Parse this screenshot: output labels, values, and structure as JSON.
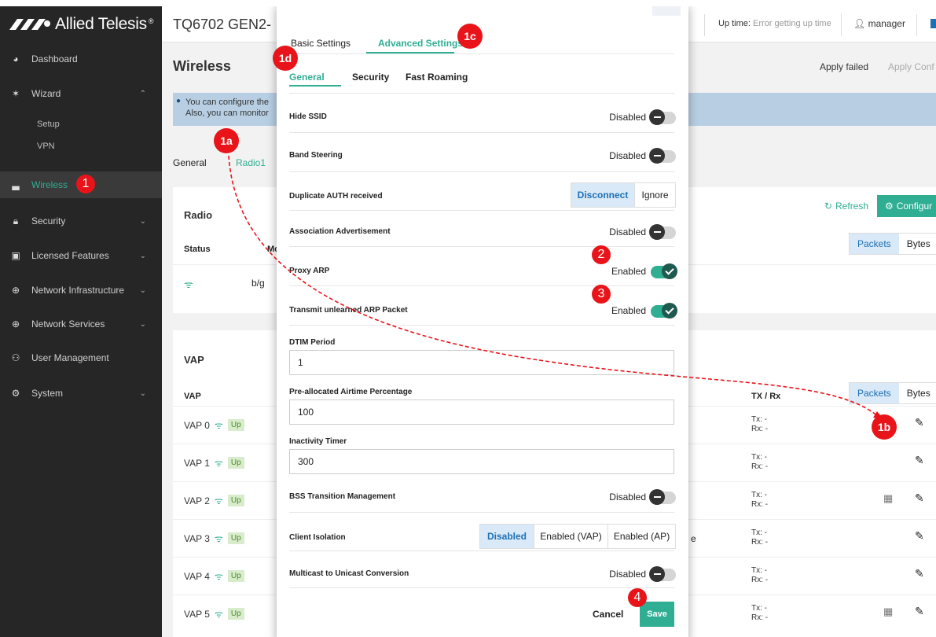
{
  "topbar": {
    "brand": "Allied Telesis",
    "product": "TQ6702 GEN2-",
    "uptime_label": "Up time:",
    "uptime_value": "Error getting up time",
    "user": "manager"
  },
  "sidebar": {
    "dashboard": "Dashboard",
    "wizard": "Wizard",
    "setup": "Setup",
    "vpn": "VPN",
    "wireless": "Wireless",
    "security": "Security",
    "licensed": "Licensed Features",
    "netinfra": "Network Infrastructure",
    "netservices": "Network Services",
    "usermgmt": "User Management",
    "system": "System"
  },
  "page": {
    "title": "Wireless",
    "apply_failed": "Apply failed",
    "apply_config": "Apply Conf",
    "info_line1": "You can configure the",
    "info_line2": "Also, you can monitor",
    "tab_general": "General",
    "tab_radio1": "Radio1"
  },
  "radio_card": {
    "title": "Radio",
    "refresh": "Refresh",
    "configure": "Configur",
    "col_status": "Status",
    "col_mode": "Mo",
    "packets": "Packets",
    "bytes": "Bytes",
    "row_mode": "b/g"
  },
  "vap_card": {
    "title": "VAP",
    "col_vap": "VAP",
    "col_txrx": "TX / Rx",
    "packets": "Packets",
    "bytes": "Bytes",
    "up": "Up",
    "tx": "Tx: -",
    "rx": "Rx: -",
    "stray": "e",
    "rows": [
      {
        "name": "VAP 0"
      },
      {
        "name": "VAP 1"
      },
      {
        "name": "VAP 2"
      },
      {
        "name": "VAP 3"
      },
      {
        "name": "VAP 4"
      },
      {
        "name": "VAP 5"
      }
    ]
  },
  "modal": {
    "tab_basic": "Basic Settings",
    "tab_advanced": "Advanced Settings",
    "subtab_general": "General",
    "subtab_security": "Security",
    "subtab_fast_roaming": "Fast Roaming",
    "hide_ssid": {
      "label": "Hide SSID",
      "value": "Disabled"
    },
    "band_steering": {
      "label": "Band Steering",
      "value": "Disabled"
    },
    "dup_auth": {
      "label": "Duplicate AUTH received",
      "opt1": "Disconnect",
      "opt2": "Ignore",
      "selected": "Disconnect"
    },
    "assoc_adv": {
      "label": "Association Advertisement",
      "value": "Disabled"
    },
    "proxy_arp": {
      "label": "Proxy ARP",
      "value": "Enabled"
    },
    "transmit_arp": {
      "label": "Transmit unlearned ARP Packet",
      "value": "Enabled"
    },
    "dtim": {
      "label": "DTIM Period",
      "value": "1"
    },
    "airtime": {
      "label": "Pre-allocated Airtime Percentage",
      "value": "100"
    },
    "inactivity": {
      "label": "Inactivity Timer",
      "value": "300"
    },
    "bss": {
      "label": "BSS Transition Management",
      "value": "Disabled"
    },
    "client_iso": {
      "label": "Client Isolation",
      "opt1": "Disabled",
      "opt2": "Enabled (VAP)",
      "opt3": "Enabled (AP)",
      "selected": "Disabled"
    },
    "mcast": {
      "label": "Multicast to Unicast Conversion",
      "value": "Disabled"
    },
    "cancel": "Cancel",
    "save": "Save"
  },
  "annotations": {
    "n1": "1",
    "n1a": "1a",
    "n1b": "1b",
    "n1c": "1c",
    "n1d": "1d",
    "n2": "2",
    "n3": "3",
    "n4": "4"
  },
  "colors": {
    "accent": "#2fae94",
    "annotation": "#e8141a",
    "sidebar_bg": "#262626",
    "selected_bg": "#d9e9f7"
  }
}
